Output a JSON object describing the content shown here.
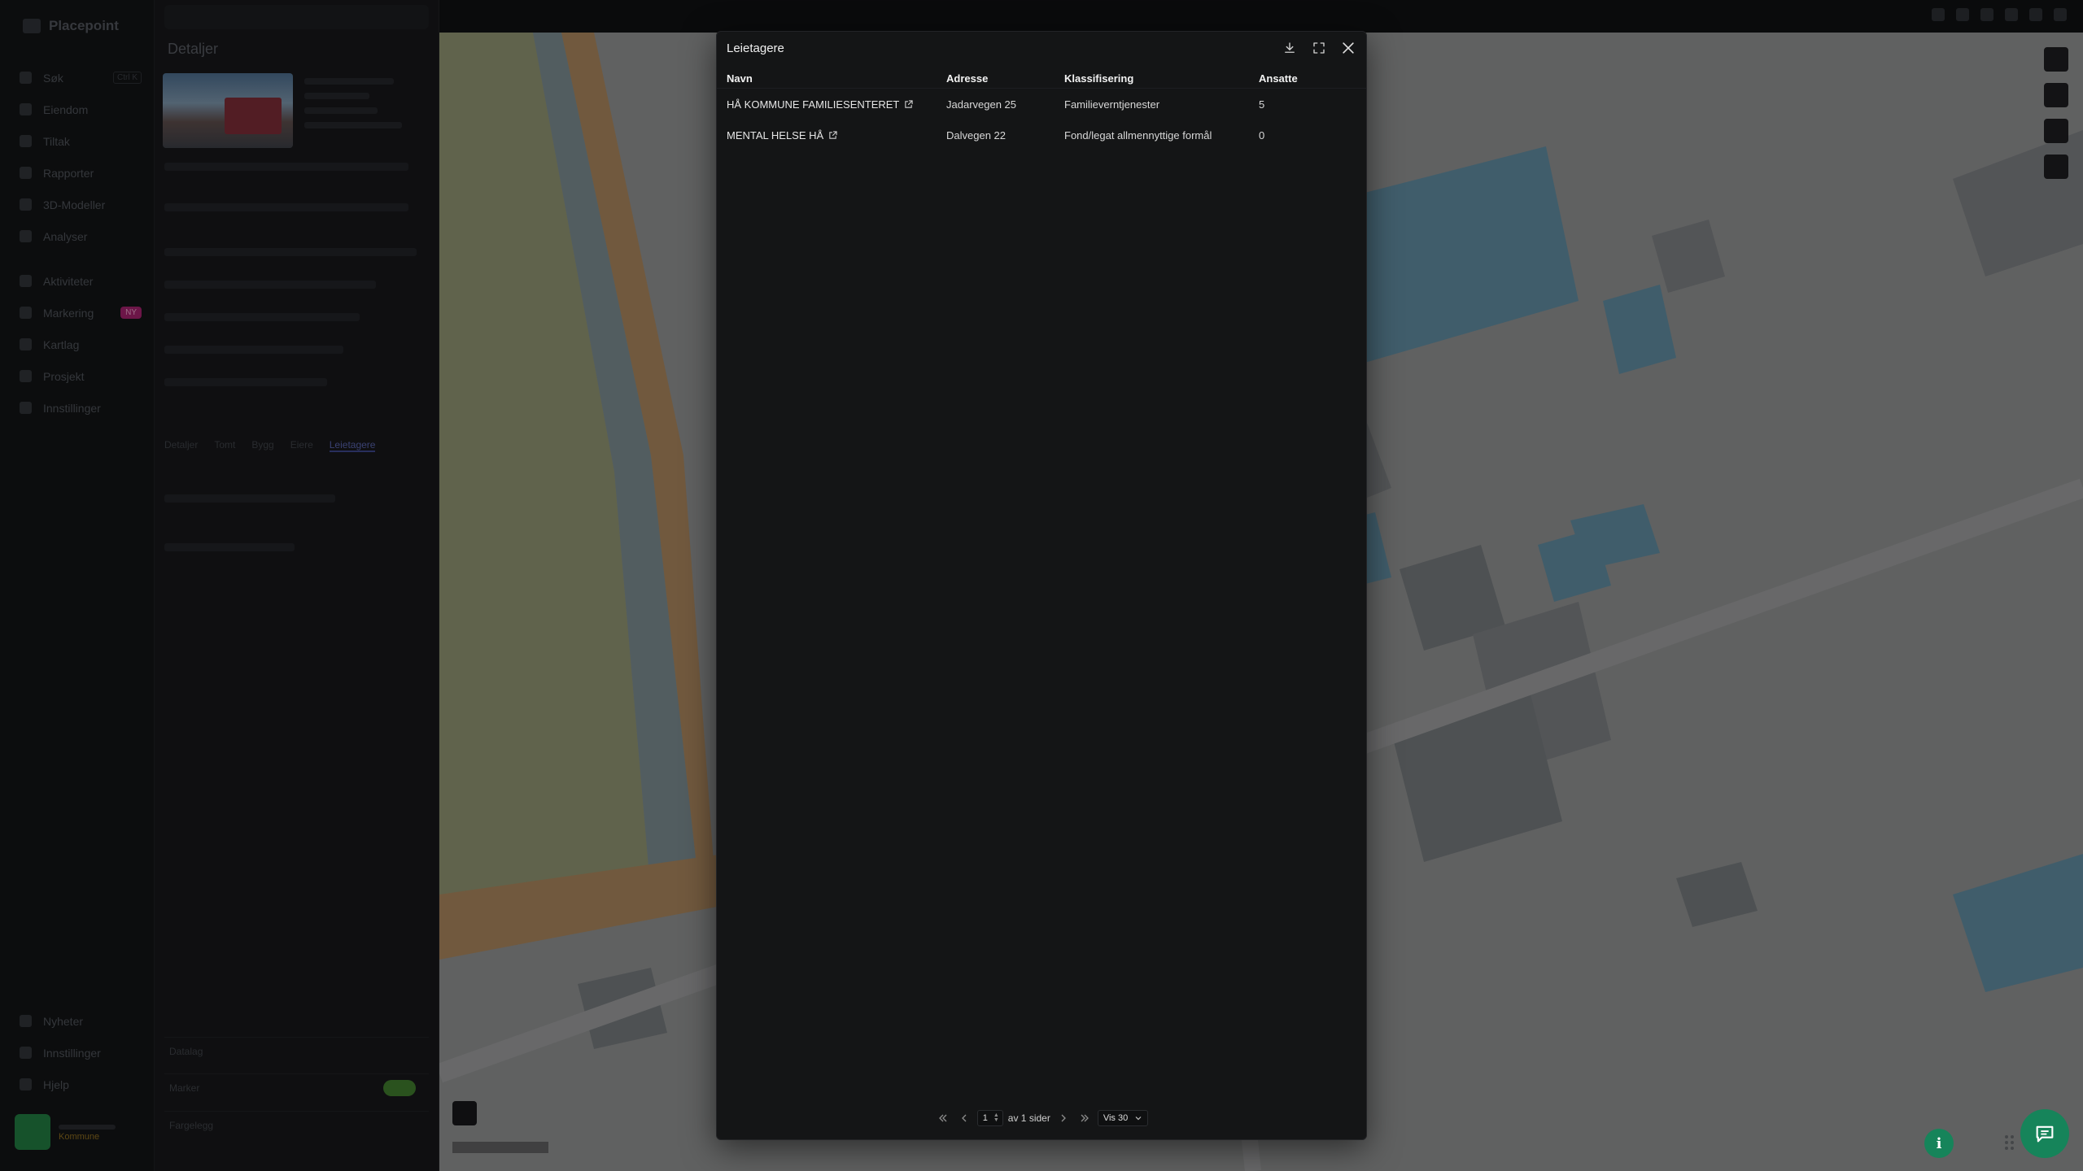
{
  "background": {
    "brand": "Placepoint",
    "nav_items": [
      {
        "label": "Søk",
        "kbd": "Ctrl K"
      },
      {
        "label": "Eiendom"
      },
      {
        "label": "Tiltak"
      },
      {
        "label": "Rapporter"
      },
      {
        "label": "3D-Modeller"
      },
      {
        "label": "Analyser"
      },
      {
        "label": "Aktiviteter"
      },
      {
        "label": "Markering",
        "badge": "NY"
      },
      {
        "label": "Kartlag"
      },
      {
        "label": "Prosjekt"
      },
      {
        "label": "Innstillinger"
      }
    ],
    "nav_bottom": [
      {
        "label": "Nyheter"
      },
      {
        "label": "Innstillinger"
      },
      {
        "label": "Hjelp"
      }
    ],
    "user_org": "Kommune",
    "panel_title": "Detaljer",
    "panel_tabs": [
      "Detaljer",
      "Tomt",
      "Bygg",
      "Eiere",
      "Leietagere"
    ],
    "panel_footers": [
      "Datalag",
      "Marker",
      "Fargelegg"
    ]
  },
  "modal": {
    "title": "Leietagere",
    "columns": [
      "Navn",
      "Adresse",
      "Klassifisering",
      "Ansatte"
    ],
    "rows": [
      {
        "name": "HÅ KOMMUNE FAMILIESENTERET",
        "address": "Jadarvegen 25",
        "classification": "Familieverntjenester",
        "employees": "5"
      },
      {
        "name": "MENTAL HELSE HÅ",
        "address": "Dalvegen 22",
        "classification": "Fond/legat allmennyttige formål",
        "employees": "0"
      }
    ],
    "pager": {
      "page": "1",
      "of_text": "av 1 sider",
      "page_size": "Vis 30"
    }
  },
  "colors": {
    "accent_green": "#16845a",
    "modal_bg": "#141516",
    "map_building_blue": "#5f8fa6",
    "map_road": "#b78a52"
  }
}
